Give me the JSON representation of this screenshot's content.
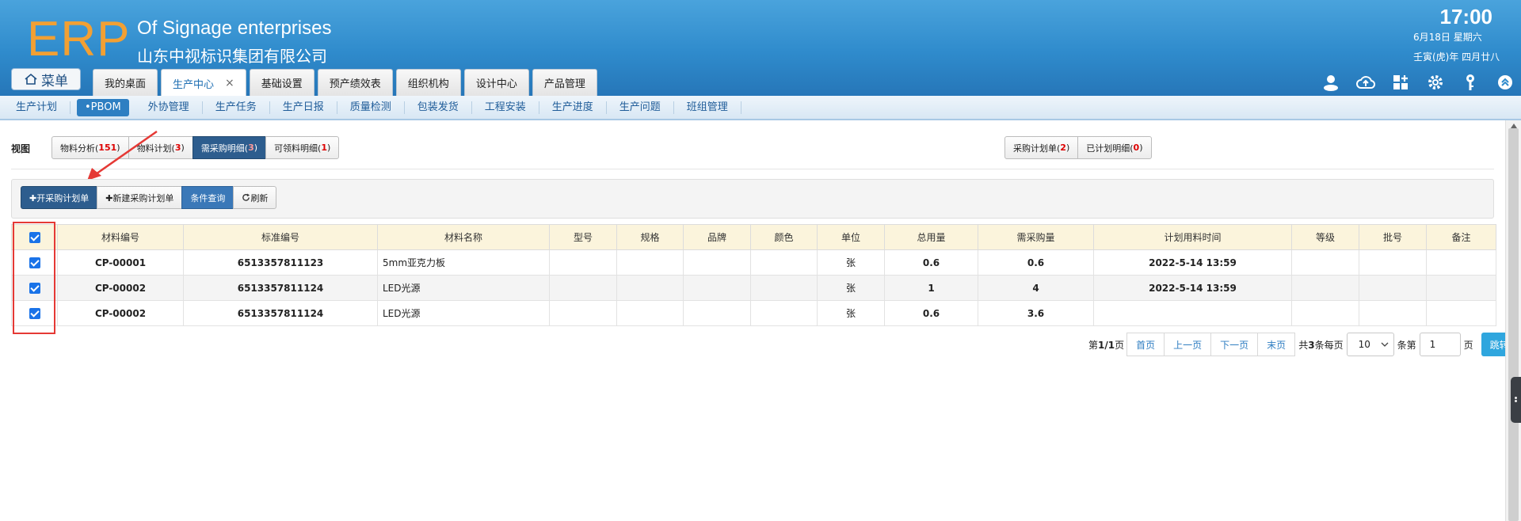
{
  "header": {
    "logo": "ERP",
    "enterprise_en": "Of Signage enterprises",
    "enterprise_cn": "山东中视标识集团有限公司",
    "time": "17:00",
    "date_line1": "6月18日 星期六",
    "date_line2": "壬寅(虎)年 四月廿八",
    "menu_label": "菜单",
    "tabs": [
      {
        "label": "我的桌面"
      },
      {
        "label": "生产中心",
        "close": "×"
      },
      {
        "label": "基础设置"
      },
      {
        "label": "预产绩效表"
      },
      {
        "label": "组织机构"
      },
      {
        "label": "设计中心"
      },
      {
        "label": "产品管理"
      }
    ],
    "icons": [
      "user-icon",
      "cloud-upload-icon",
      "apps-grid-icon",
      "gear-icon",
      "key-icon",
      "double-chevron-up-icon"
    ]
  },
  "subnav": [
    "生产计划",
    "•PBOM",
    "外协管理",
    "生产任务",
    "生产日报",
    "质量检测",
    "包装发货",
    "工程安装",
    "生产进度",
    "生产问题",
    "班组管理"
  ],
  "view": {
    "label": "视图",
    "left_tabs": [
      {
        "text": "物料分析(",
        "count": "151",
        "close": ")"
      },
      {
        "text": "物料计划(",
        "count": "3",
        "close": ")"
      },
      {
        "text": "需采购明细(",
        "count": "3",
        "close": ")"
      },
      {
        "text": "可领料明细(",
        "count": "1",
        "close": ")"
      }
    ],
    "right_tabs": [
      {
        "text": "采购计划单(",
        "count": "2",
        "close": ")"
      },
      {
        "text": "已计划明细(",
        "count": "0",
        "close": ")"
      }
    ]
  },
  "toolbar": {
    "open_purchase": "✚开采购计划单",
    "new_purchase": "✚新建采购计划单",
    "condition_query": "条件查询",
    "refresh": "刷新"
  },
  "table": {
    "columns": [
      "材料编号",
      "标准编号",
      "材料名称",
      "型号",
      "规格",
      "品牌",
      "颜色",
      "单位",
      "总用量",
      "需采购量",
      "计划用料时间",
      "等级",
      "批号",
      "备注"
    ],
    "rows": [
      [
        "CP-00001",
        "6513357811123",
        "5mm亚克力板",
        "",
        "",
        "",
        "",
        "张",
        "0.6",
        "0.6",
        "2022-5-14 13:59",
        "",
        "",
        ""
      ],
      [
        "CP-00002",
        "6513357811124",
        "LED光源",
        "",
        "",
        "",
        "",
        "张",
        "1",
        "4",
        "2022-5-14 13:59",
        "",
        "",
        ""
      ],
      [
        "CP-00002",
        "6513357811124",
        "LED光源",
        "",
        "",
        "",
        "",
        "张",
        "0.6",
        "3.6",
        "",
        "",
        "",
        ""
      ]
    ]
  },
  "pager": {
    "page_prefix": "第",
    "page_value": "1/1",
    "page_suffix": "页",
    "first": "首页",
    "prev": "上一页",
    "next": "下一页",
    "last": "末页",
    "total_prefix": "共",
    "total_value": "3",
    "total_suffix": "条每页",
    "page_size": "10",
    "goto_prefix": "条第",
    "goto_value": "1",
    "goto_suffix": "页",
    "go": "跳转"
  },
  "colors": {
    "header_blue": "#2f8bcc",
    "logo_orange": "#f2a033",
    "active_dark": "#2d5d8e",
    "highlight_red": "#e53935",
    "checkbox_blue": "#1a73e8"
  }
}
